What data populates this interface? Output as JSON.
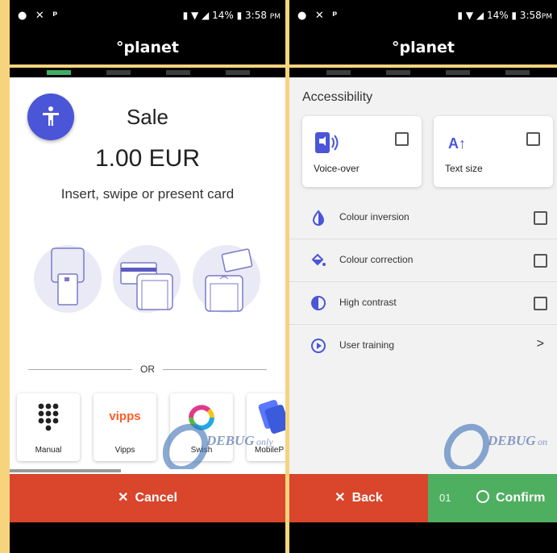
{
  "status_bar": {
    "left_icons": "● ✕ ᵖ",
    "battery": "14%",
    "time": "3:58",
    "time_suffix": "PM"
  },
  "brand": "°planet",
  "sale_screen": {
    "title": "Sale",
    "amount": "1.00 EUR",
    "instruction": "Insert, swipe or present card",
    "or_label": "OR",
    "payment_options": [
      {
        "label": "Manual",
        "icon": "keypad-icon"
      },
      {
        "label": "Vipps",
        "icon": "vipps-logo"
      },
      {
        "label": "Swish",
        "icon": "swish-logo"
      },
      {
        "label": "MobileP",
        "icon": "mobilepay-logo"
      }
    ],
    "vipps_logo_text": "vipps",
    "cancel_label": "Cancel",
    "watermark_text": "DEBUG",
    "watermark_suffix": "only"
  },
  "accessibility_screen": {
    "title": "Accessibility",
    "cards": [
      {
        "label": "Voice-over",
        "icon": "voice-over-icon",
        "checked": false
      },
      {
        "label": "Text size",
        "icon": "text-size-icon",
        "glyph": "A↑",
        "checked": false
      }
    ],
    "options": [
      {
        "label": "Colour inversion",
        "icon": "colour-inversion-icon",
        "control": "checkbox"
      },
      {
        "label": "Colour correction",
        "icon": "colour-correction-icon",
        "control": "checkbox"
      },
      {
        "label": "High contrast",
        "icon": "high-contrast-icon",
        "control": "checkbox"
      },
      {
        "label": "User training",
        "icon": "play-circle-icon",
        "control": "chevron",
        "chevron": ">"
      }
    ],
    "back_label": "Back",
    "confirm_number": "01",
    "confirm_label": "Confirm",
    "watermark_text": "DEBUG",
    "watermark_suffix": "on"
  },
  "colors": {
    "accent_blue": "#4a55d8",
    "cancel_red": "#d9462b",
    "confirm_green": "#4faf60",
    "step_active": "#3fae63"
  }
}
